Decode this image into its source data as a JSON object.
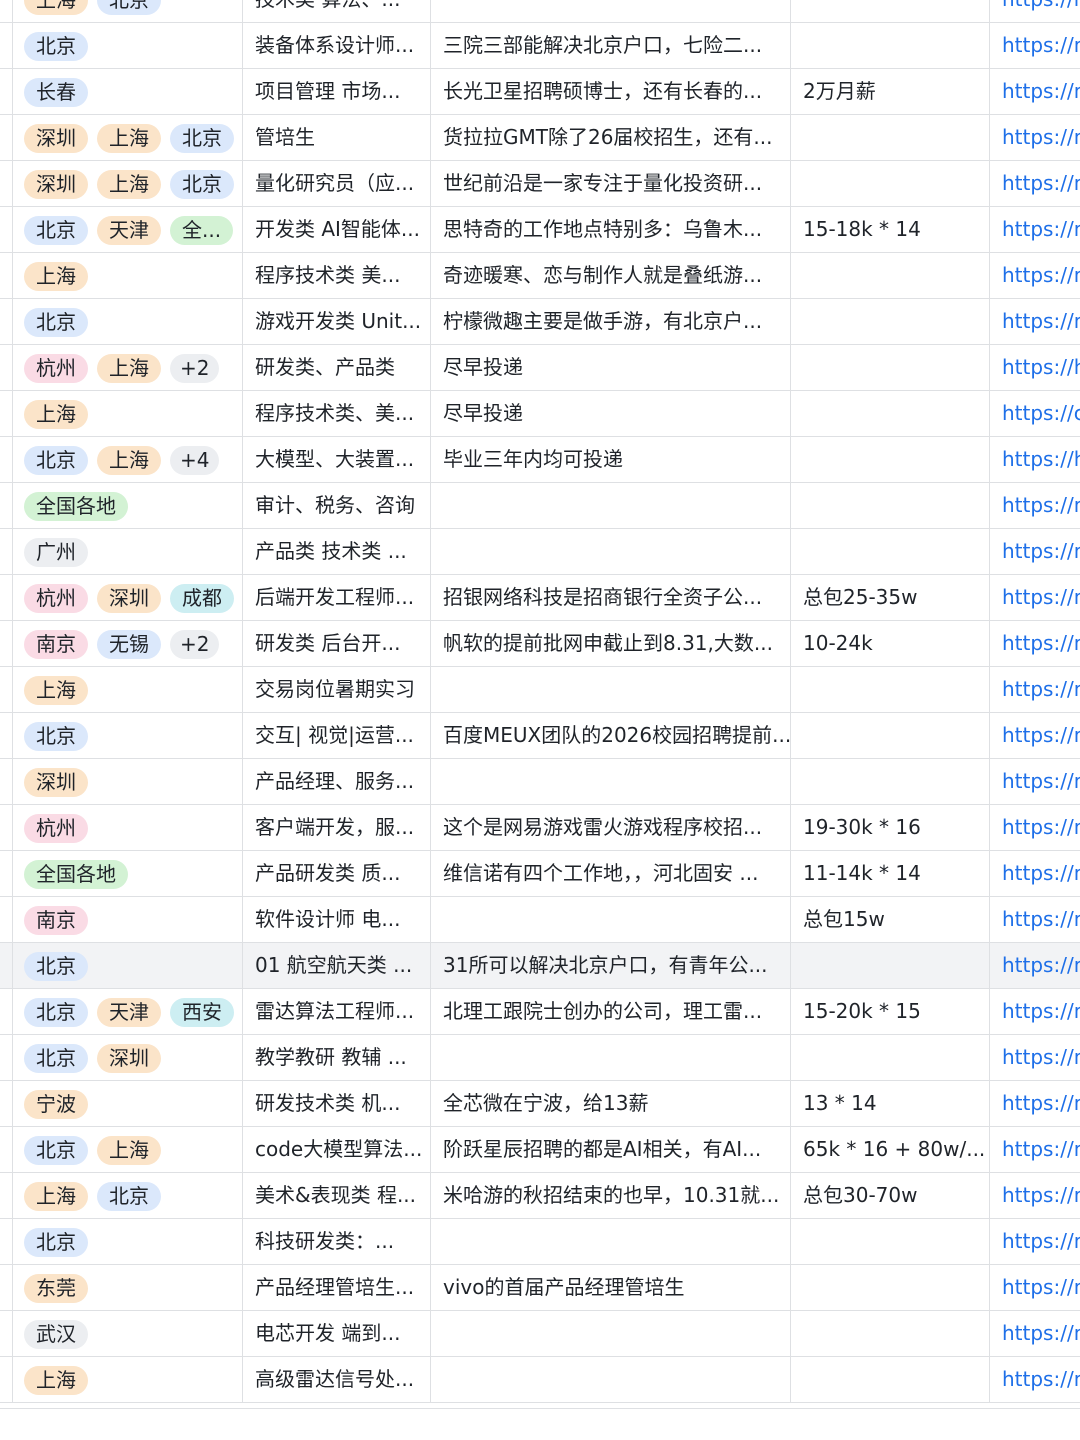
{
  "colors": {
    "blue": "#dbe8fb",
    "orange": "#fbe4c9",
    "pink": "#fadbe5",
    "green": "#d3f2d4",
    "teal": "#cdeef2",
    "grey": "#eceef1",
    "link": "#1e6fe8",
    "border": "#dee0e3",
    "highlight": "#f2f3f5"
  },
  "rows": [
    {
      "cities": [
        {
          "name": "上海",
          "color": "orange"
        },
        {
          "name": "北京",
          "color": "blue"
        }
      ],
      "position": "技术类 算法、...",
      "desc": "",
      "salary": "",
      "link": "https://m"
    },
    {
      "cities": [
        {
          "name": "北京",
          "color": "blue"
        }
      ],
      "position": "装备体系设计师...",
      "desc": "三院三部能解决北京户口，七险二...",
      "salary": "",
      "link": "https://m"
    },
    {
      "cities": [
        {
          "name": "长春",
          "color": "blue"
        }
      ],
      "position": "项目管理 市场...",
      "desc": "长光卫星招聘硕博士，还有长春的...",
      "salary": "2万月薪",
      "link": "https://m"
    },
    {
      "cities": [
        {
          "name": "深圳",
          "color": "orange"
        },
        {
          "name": "上海",
          "color": "orange"
        },
        {
          "name": "北京",
          "color": "blue"
        }
      ],
      "position": "管培生",
      "desc": "货拉拉GMT除了26届校招生，还有...",
      "salary": "",
      "link": "https://m"
    },
    {
      "cities": [
        {
          "name": "深圳",
          "color": "orange"
        },
        {
          "name": "上海",
          "color": "orange"
        },
        {
          "name": "北京",
          "color": "blue"
        }
      ],
      "position": "量化研究员（应...",
      "desc": "世纪前沿是一家专注于量化投资研...",
      "salary": "",
      "link": "https://m"
    },
    {
      "cities": [
        {
          "name": "北京",
          "color": "blue"
        },
        {
          "name": "天津",
          "color": "orange"
        },
        {
          "name": "全...",
          "color": "green"
        }
      ],
      "position": "开发类 AI智能体...",
      "desc": "思特奇的工作地点特别多：乌鲁木...",
      "salary": "15-18k * 14",
      "link": "https://m"
    },
    {
      "cities": [
        {
          "name": "上海",
          "color": "orange"
        }
      ],
      "position": "程序技术类 美...",
      "desc": "奇迹暖寒、恋与制作人就是叠纸游...",
      "salary": "",
      "link": "https://m"
    },
    {
      "cities": [
        {
          "name": "北京",
          "color": "blue"
        }
      ],
      "position": "游戏开发类 Unit...",
      "desc": "柠檬微趣主要是做手游，有北京户...",
      "salary": "",
      "link": "https://m"
    },
    {
      "cities": [
        {
          "name": "杭州",
          "color": "pink"
        },
        {
          "name": "上海",
          "color": "orange"
        },
        {
          "name": "+2",
          "color": "more"
        }
      ],
      "position": "研发类、产品类",
      "desc": "尽早投递",
      "salary": "",
      "link": "https://h"
    },
    {
      "cities": [
        {
          "name": "上海",
          "color": "orange"
        }
      ],
      "position": "程序技术类、美...",
      "desc": "尽早投递",
      "salary": "",
      "link": "https://c"
    },
    {
      "cities": [
        {
          "name": "北京",
          "color": "blue"
        },
        {
          "name": "上海",
          "color": "orange"
        },
        {
          "name": "+4",
          "color": "more"
        }
      ],
      "position": "大模型、大装置...",
      "desc": "毕业三年内均可投递",
      "salary": "",
      "link": "https://h"
    },
    {
      "cities": [
        {
          "name": "全国各地",
          "color": "green"
        }
      ],
      "position": "审计、税务、咨询",
      "desc": "",
      "salary": "",
      "link": "https://m"
    },
    {
      "cities": [
        {
          "name": "广州",
          "color": "grey"
        }
      ],
      "position": "产品类 技术类 ...",
      "desc": "",
      "salary": "",
      "link": "https://m"
    },
    {
      "cities": [
        {
          "name": "杭州",
          "color": "pink"
        },
        {
          "name": "深圳",
          "color": "orange"
        },
        {
          "name": "成都",
          "color": "teal"
        }
      ],
      "position": "后端开发工程师...",
      "desc": "招银网络科技是招商银行全资子公...",
      "salary": "总包25-35w",
      "link": "https://m"
    },
    {
      "cities": [
        {
          "name": "南京",
          "color": "pink"
        },
        {
          "name": "无锡",
          "color": "blue"
        },
        {
          "name": "+2",
          "color": "more"
        }
      ],
      "position": "研发类 后台开...",
      "desc": "帆软的提前批网申截止到8.31,大数...",
      "salary": "10-24k",
      "link": "https://m"
    },
    {
      "cities": [
        {
          "name": "上海",
          "color": "orange"
        }
      ],
      "position": "交易岗位暑期实习",
      "desc": "",
      "salary": "",
      "link": "https://m"
    },
    {
      "cities": [
        {
          "name": "北京",
          "color": "blue"
        }
      ],
      "position": "交互| 视觉|运营...",
      "desc": "百度MEUX团队的2026校园招聘提前...",
      "salary": "",
      "link": "https://m"
    },
    {
      "cities": [
        {
          "name": "深圳",
          "color": "orange"
        }
      ],
      "position": "产品经理、服务...",
      "desc": "",
      "salary": "",
      "link": "https://m"
    },
    {
      "cities": [
        {
          "name": "杭州",
          "color": "pink"
        }
      ],
      "position": "客户端开发，服...",
      "desc": "这个是网易游戏雷火游戏程序校招...",
      "salary": "19-30k * 16",
      "link": "https://m"
    },
    {
      "cities": [
        {
          "name": "全国各地",
          "color": "green"
        }
      ],
      "position": "产品研发类 质...",
      "desc": "维信诺有四个工作地，，河北固安 ...",
      "salary": "11-14k * 14",
      "link": "https://m"
    },
    {
      "cities": [
        {
          "name": "南京",
          "color": "pink"
        }
      ],
      "position": "软件设计师 电...",
      "desc": "",
      "salary": "总包15w",
      "link": "https://m"
    },
    {
      "cities": [
        {
          "name": "北京",
          "color": "blue"
        }
      ],
      "position": "01 航空航天类 ...",
      "desc": "31所可以解决北京户口，有青年公...",
      "salary": "",
      "link": "https://m",
      "highlight": true
    },
    {
      "cities": [
        {
          "name": "北京",
          "color": "blue"
        },
        {
          "name": "天津",
          "color": "orange"
        },
        {
          "name": "西安",
          "color": "teal"
        }
      ],
      "position": "雷达算法工程师...",
      "desc": "北理工跟院士创办的公司，理工雷...",
      "salary": "15-20k * 15",
      "link": "https://m"
    },
    {
      "cities": [
        {
          "name": "北京",
          "color": "blue"
        },
        {
          "name": "深圳",
          "color": "orange"
        }
      ],
      "position": "教学教研 教辅 ...",
      "desc": "",
      "salary": "",
      "link": "https://m"
    },
    {
      "cities": [
        {
          "name": "宁波",
          "color": "orange"
        }
      ],
      "position": "研发技术类 机...",
      "desc": "全芯微在宁波，给13薪",
      "salary": "13 * 14",
      "link": "https://m"
    },
    {
      "cities": [
        {
          "name": "北京",
          "color": "blue"
        },
        {
          "name": "上海",
          "color": "orange"
        }
      ],
      "position": "code大模型算法...",
      "desc": "阶跃星辰招聘的都是AI相关，有AI...",
      "salary": "65k * 16 + 80w/...",
      "link": "https://m"
    },
    {
      "cities": [
        {
          "name": "上海",
          "color": "orange"
        },
        {
          "name": "北京",
          "color": "blue"
        }
      ],
      "position": "美术&表现类 程...",
      "desc": "米哈游的秋招结束的也早，10.31就...",
      "salary": "总包30-70w",
      "link": "https://m"
    },
    {
      "cities": [
        {
          "name": "北京",
          "color": "blue"
        }
      ],
      "position": "科技研发类：...",
      "desc": "",
      "salary": "",
      "link": "https://m"
    },
    {
      "cities": [
        {
          "name": "东莞",
          "color": "orange"
        }
      ],
      "position": "产品经理管培生...",
      "desc": "vivo的首届产品经理管培生",
      "salary": "",
      "link": "https://m"
    },
    {
      "cities": [
        {
          "name": "武汉",
          "color": "grey"
        }
      ],
      "position": "电芯开发 端到...",
      "desc": "",
      "salary": "",
      "link": "https://m"
    },
    {
      "cities": [
        {
          "name": "上海",
          "color": "orange"
        }
      ],
      "position": "高级雷达信号处...",
      "desc": "",
      "salary": "",
      "link": "https://m"
    }
  ]
}
